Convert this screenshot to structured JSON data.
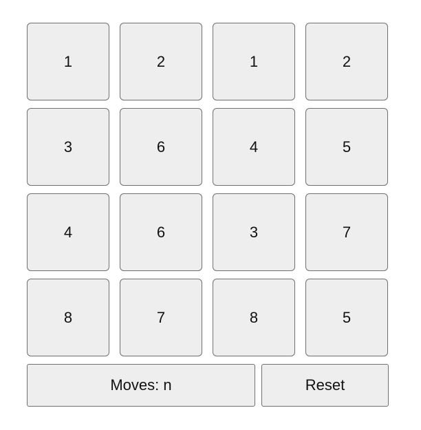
{
  "board": {
    "tiles": [
      "1",
      "2",
      "1",
      "2",
      "3",
      "6",
      "4",
      "5",
      "4",
      "6",
      "3",
      "7",
      "8",
      "7",
      "8",
      "5"
    ]
  },
  "controls": {
    "moves_label": "Moves: n",
    "reset_label": "Reset"
  },
  "colors": {
    "tile_background": "#eeeeee",
    "tile_border": "#6f6f6f",
    "text": "#111111"
  }
}
